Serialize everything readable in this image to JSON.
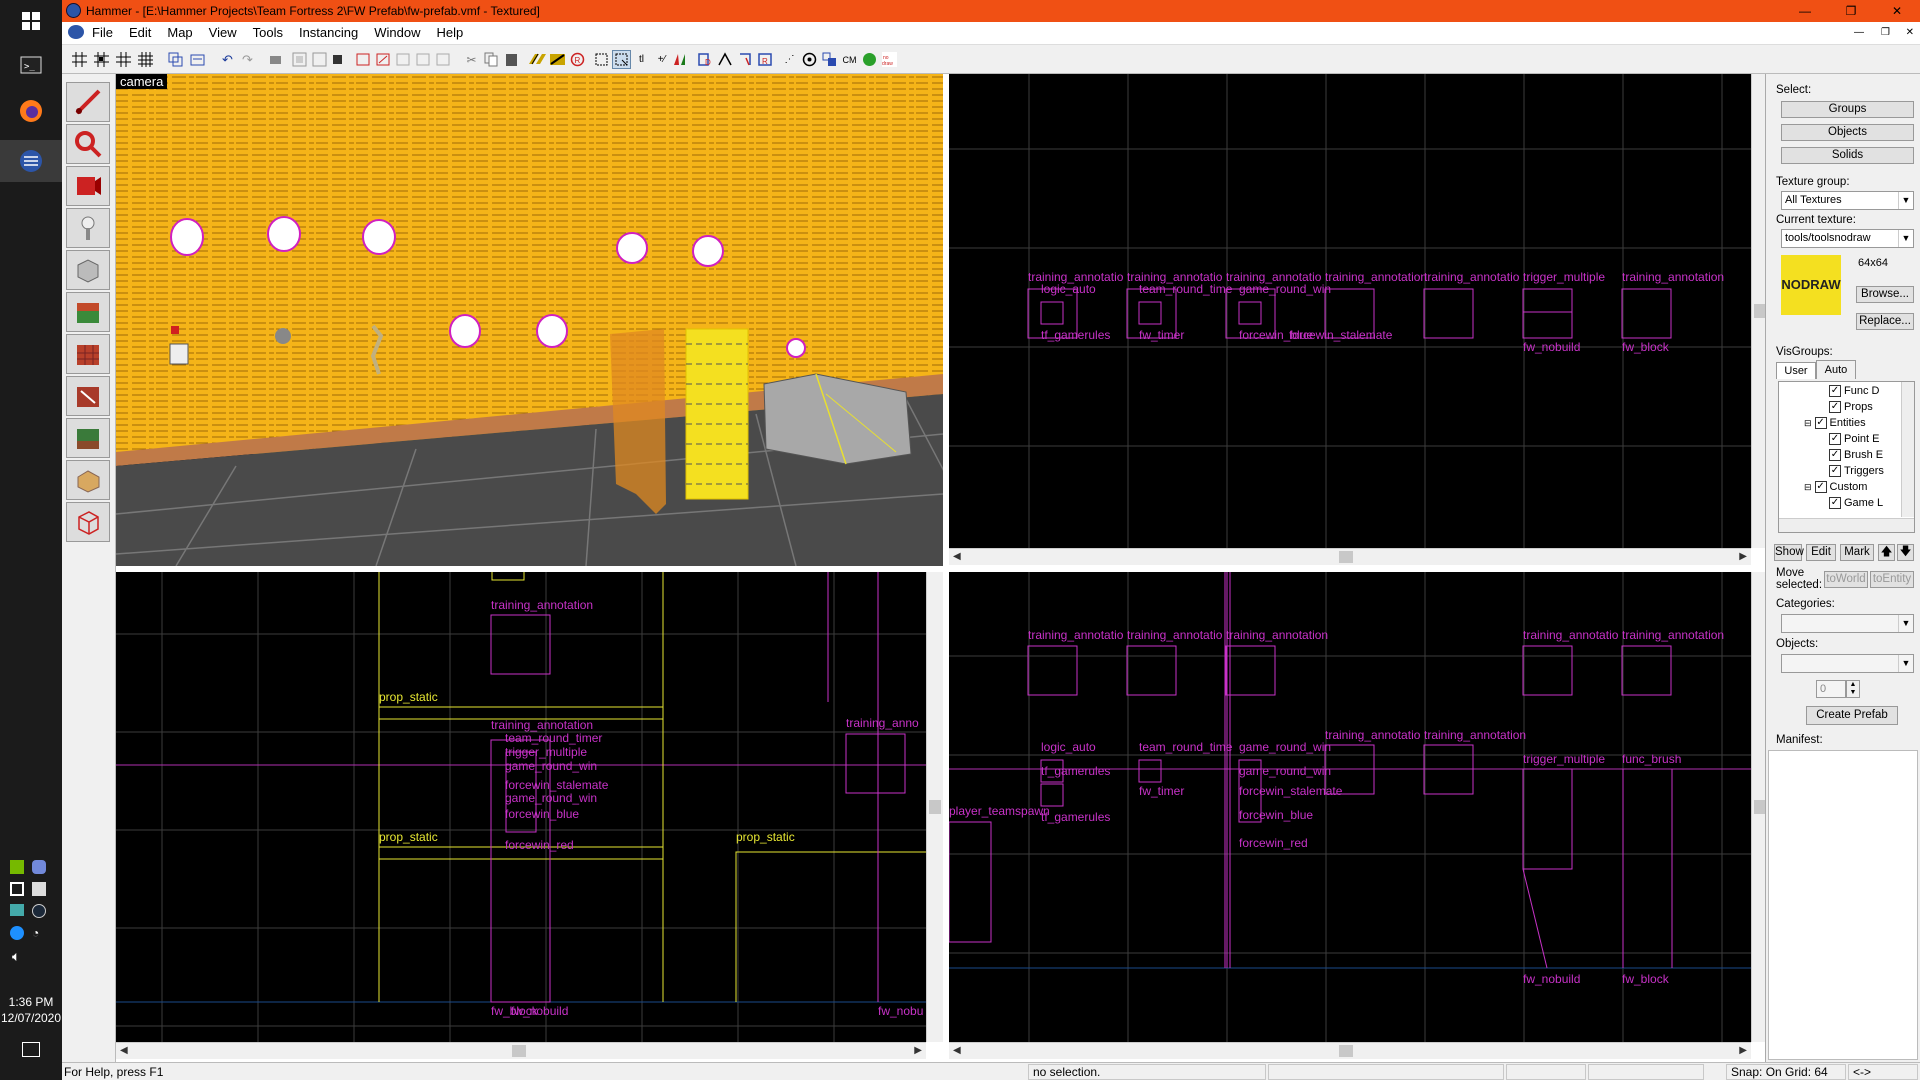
{
  "window": {
    "title": "Hammer - [E:\\Hammer Projects\\Team Fortress 2\\FW Prefab\\fw-prefab.vmf - Textured]"
  },
  "menu": [
    "File",
    "Edit",
    "Map",
    "View",
    "Tools",
    "Instancing",
    "Window",
    "Help"
  ],
  "taskbar": {
    "time": "1:36 PM",
    "date": "12/07/2020"
  },
  "viewports": {
    "camera_label": "camera",
    "top_right": {
      "labels": [
        "training_annotatio",
        "training_annotatio",
        "training_annotatio",
        "training_annotation",
        "training_annotatio",
        "trigger_multiple",
        "training_annotation",
        "logic_auto",
        "team_round_time",
        "game_round_win",
        "tf_gamerules",
        "fw_timer",
        "forcewin_blue",
        "forcewin_stalemate",
        "fw_nobuild",
        "fw_block"
      ]
    },
    "bottom_left": {
      "labels": [
        "training_annotation",
        "prop_static",
        "training_annotation",
        "team_round_timer",
        "trigger_multiple",
        "game_round_win",
        "forcewin_stalemate",
        "game_round_win",
        "forcewin_blue",
        "prop_static",
        "forcewin_red",
        "prop_static",
        "training_anno",
        "fw_block",
        "fw_nobuild",
        "fw_nobu"
      ]
    },
    "bottom_right": {
      "labels": [
        "training_annotatio",
        "training_annotatio",
        "training_annotation",
        "training_annotatio",
        "training_annotation",
        "logic_auto",
        "team_round_time",
        "game_round_win",
        "training_annotatio",
        "training_annotation",
        "trigger_multiple",
        "func_brush",
        "tf_gamerules",
        "fw_timer",
        "game_round_win",
        "forcewin_stalemate",
        "forcewin_blue",
        "player_teamspawn",
        "tf_gamerules",
        "forcewin_red",
        "fw_nobuild",
        "fw_block"
      ]
    }
  },
  "right_panel": {
    "select_label": "Select:",
    "select_buttons": [
      "Groups",
      "Objects",
      "Solids"
    ],
    "texture_group_label": "Texture group:",
    "texture_group_value": "All Textures",
    "current_texture_label": "Current texture:",
    "current_texture_value": "tools/toolsnodraw",
    "texture_size": "64x64",
    "texture_preview_text": "NODRAW",
    "browse_label": "Browse...",
    "replace_label": "Replace...",
    "visgroups_label": "VisGroups:",
    "visgroup_tabs": [
      "User",
      "Auto"
    ],
    "visgroup_items": [
      "Func D",
      "Props",
      "Entities",
      "Point E",
      "Brush E",
      "Triggers",
      "Custom",
      "Game L"
    ],
    "visgroup_buttons": [
      "Show",
      "Edit",
      "Mark"
    ],
    "move_selected_label": "Move selected:",
    "to_world": "toWorld",
    "to_entity": "toEntity",
    "categories_label": "Categories:",
    "objects_label": "Objects:",
    "objects_spinner": "0",
    "create_prefab": "Create Prefab",
    "manifest_label": "Manifest:"
  },
  "status": {
    "help": "For Help, press F1",
    "selection": "no selection.",
    "snap": "Snap: On Grid: 64",
    "arrows": "<->"
  },
  "colors": {
    "title_accent": "#f05014",
    "entity": "#c832c8",
    "prop": "#e6e632",
    "grid": "#3c3c3c",
    "camera_wall": "#f5b418"
  }
}
